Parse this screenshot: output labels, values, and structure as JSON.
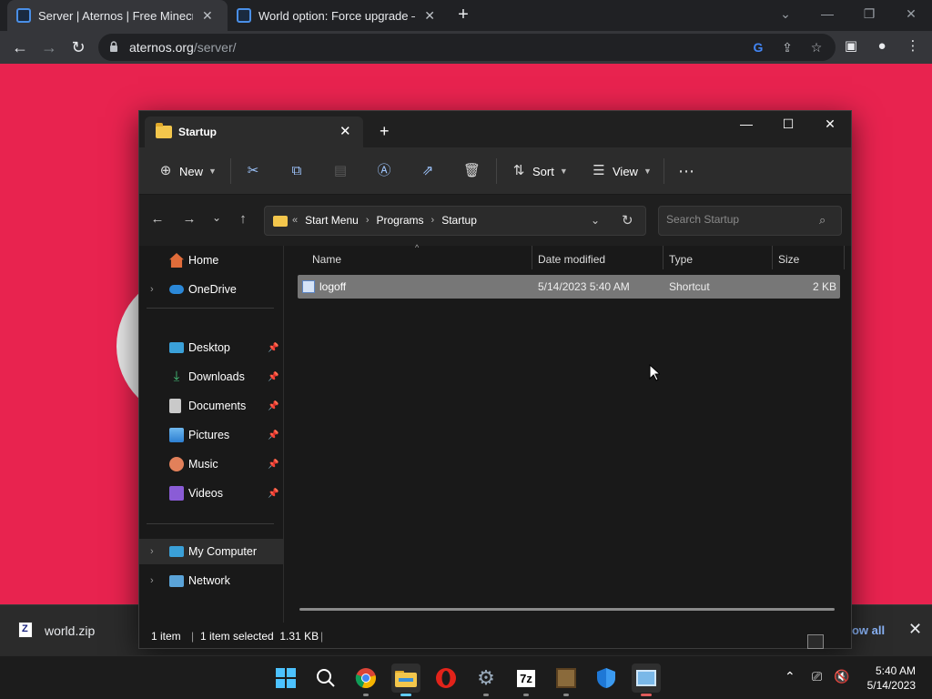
{
  "browser": {
    "tabs": [
      {
        "title": "Server | Aternos | Free Minecraft",
        "active": true
      },
      {
        "title": "World option: Force upgrade – A",
        "active": false
      }
    ],
    "url_host": "aternos.org",
    "url_path": "/server/"
  },
  "download_bar": {
    "filename": "world.zip",
    "show_all": "how all"
  },
  "explorer": {
    "tab_title": "Startup",
    "commands": {
      "new": "New",
      "sort": "Sort",
      "view": "View"
    },
    "breadcrumb": [
      "Start Menu",
      "Programs",
      "Startup"
    ],
    "breadcrumb_overflow": "«",
    "search_placeholder": "Search Startup",
    "nav": {
      "home": "Home",
      "onedrive": "OneDrive",
      "desktop": "Desktop",
      "downloads": "Downloads",
      "documents": "Documents",
      "pictures": "Pictures",
      "music": "Music",
      "videos": "Videos",
      "my_computer": "My Computer",
      "network": "Network"
    },
    "columns": {
      "name": "Name",
      "date_modified": "Date modified",
      "type": "Type",
      "size": "Size"
    },
    "files": [
      {
        "name": "logoff",
        "date_modified": "5/14/2023 5:40 AM",
        "type": "Shortcut",
        "size": "2 KB",
        "selected": true
      }
    ],
    "status": {
      "items": "1 item",
      "selected": "1 item selected  1.31 KB"
    }
  },
  "taskbar": {
    "time": "5:40 AM",
    "date": "5/14/2023"
  },
  "colors": {
    "page_bg": "#e8234f",
    "selection": "#777777",
    "accent": "#60cdff"
  }
}
